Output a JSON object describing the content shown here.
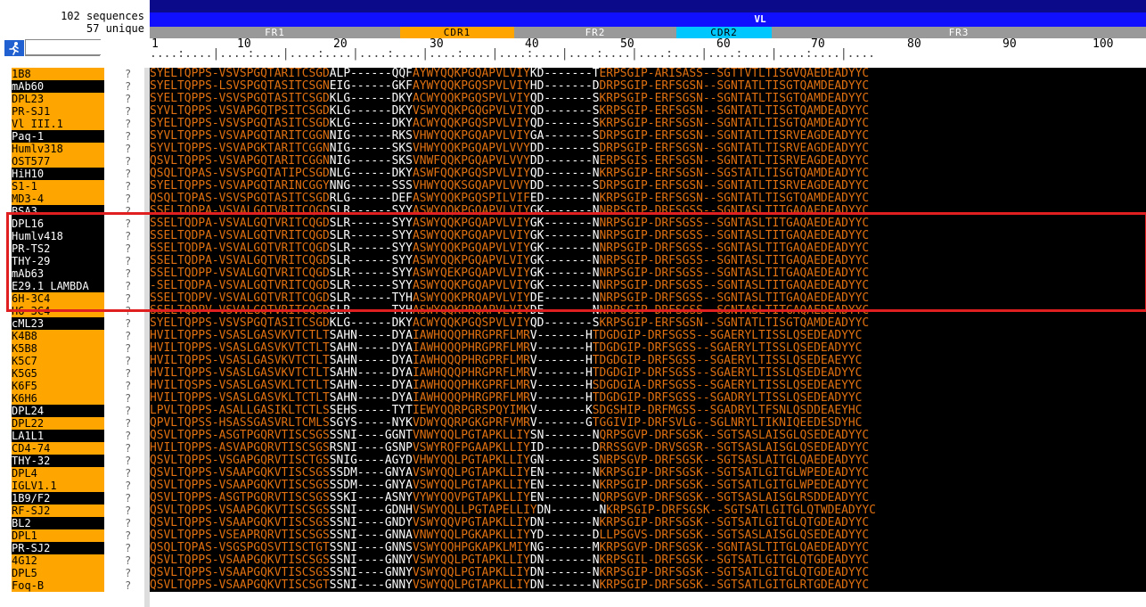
{
  "header": {
    "sequence_count": "102 sequences",
    "unique_count": "57 unique"
  },
  "domain_label": "VL",
  "regions": [
    {
      "label": "FR1",
      "type": "fr"
    },
    {
      "label": "CDR1",
      "type": "cdr1"
    },
    {
      "label": "FR2",
      "type": "fr"
    },
    {
      "label": "CDR2",
      "type": "cdr2"
    },
    {
      "label": "FR3",
      "type": "fr"
    }
  ],
  "ruler": {
    "ticks": [
      "1",
      "10",
      "20",
      "30",
      "40",
      "50",
      "60",
      "70",
      "80",
      "90",
      "100"
    ],
    "dots": "....:....|....:....|....:....|....:....|....:....|....:....|....:....|....:....|....:....|....:....|...."
  },
  "search": {
    "placeholder": ""
  },
  "colors": {
    "orange_name": "#ffa500",
    "residue": "#e07010",
    "cdr": "#ffffff",
    "highlight": "#e02020"
  },
  "sequences": [
    {
      "name": "1B8",
      "style": "orange",
      "q": "?",
      "fr1": "SYELTQPPS-VSVSPGQTARITCSGD",
      "cdr1": "ALP------QQF",
      "fr2": "AYWYQQKPGQAPVLVIY",
      "cdr2": "KD-------T",
      "fr3": "ERPSGIP-ARISASS--SGTTVTLTISGVQAEDEADYYC"
    },
    {
      "name": "mAb60",
      "style": "black",
      "q": "?",
      "fr1": "SYELTQPPS-LSVSPGQTASITCSGN",
      "cdr1": "EIG------GKF",
      "fr2": "AYWYQQKPGQSPVLVIY",
      "cdr2": "HD-------D",
      "fr3": "DRPSGIP-ERFSGSN--SGNTATLTISGTQAMDEADYYC"
    },
    {
      "name": "DPL23",
      "style": "orange",
      "q": "?",
      "fr1": "SYELTQPPS-VSVSPGQTASITCSGD",
      "cdr1": "KLG------DKY",
      "fr2": "ACWYQQKPGQSPVLVIY",
      "cdr2": "QD-------S",
      "fr3": "KRPSGIP-ERFSGSN--SGNTATLTISGTQAMDEADYYC"
    },
    {
      "name": "PR-SJ1",
      "style": "orange",
      "q": "?",
      "fr1": "SYVLTQPPS-VSVAPGQTPSITCSGD",
      "cdr1": "KLG------DKY",
      "fr2": "VSWYQQKPGQGPVLVIY",
      "cdr2": "QD-------S",
      "fr3": "KRPSGIP-ERFSGSN--SGNTATLTISGTQAMDEADYYC"
    },
    {
      "name": "Vl III.1",
      "style": "orange",
      "q": "?",
      "fr1": "SYELTQPPS-VSVSPGQTASITCSGD",
      "cdr1": "KLG------DKY",
      "fr2": "ACWYQQKPGQSPVLVIY",
      "cdr2": "QD-------S",
      "fr3": "KRPSGIP-ERFSGSN--SGNTATLTISGTQAMDEADYYC"
    },
    {
      "name": "Paq-1",
      "style": "black",
      "q": "?",
      "fr1": "SYVLTQPPS-VSVAPGQTARITCGGN",
      "cdr1": "NIG------RKS",
      "fr2": "VHWYQQKPGQAPVLVIY",
      "cdr2": "GA-------S",
      "fr3": "DRPSGIP-ERFSGSN--SGNTATLTISRVEAGDEADYYC"
    },
    {
      "name": "Humlv318",
      "style": "orange",
      "q": "?",
      "fr1": "SYVLTQPPS-VSVAPGKTARITCGGN",
      "cdr1": "NIG------SKS",
      "fr2": "VHWYQQKPGQAPVLVVY",
      "cdr2": "DD-------S",
      "fr3": "DRPSGIP-ERFSGSN--SGNTATLTISRVEAGDEADYYC"
    },
    {
      "name": "OST577",
      "style": "orange",
      "q": "?",
      "fr1": "QSVLTQPPS-VSVAPGQTARITCGGN",
      "cdr1": "NIG------SKS",
      "fr2": "VNWFQQKPGQAPVLVVY",
      "cdr2": "DD-------N",
      "fr3": "ERPSGIS-ERFSGSN--SGNTATLTISRVEAGDEADYYC"
    },
    {
      "name": "HiH10",
      "style": "black",
      "q": "?",
      "fr1": "QSQLTQPAS-VSVSPGQTATIPCSGD",
      "cdr1": "NLG------DKY",
      "fr2": "ASWFQQKPGQSPVLVIY",
      "cdr2": "QD-------N",
      "fr3": "KRPSGIP-ERFSGSN--SGSTATLTISGTQAMDEADYYC"
    },
    {
      "name": "S1-1",
      "style": "orange",
      "q": "?",
      "fr1": "SYELTQPPS-VSVAPGQTARINCGGY",
      "cdr1": "NNG------SSS",
      "fr2": "VHWYQQKSGQAPVLVVY",
      "cdr2": "DD-------S",
      "fr3": "DRPSGIP-ERFSGSN--SGNTATLTISRVEAGDEADYYC"
    },
    {
      "name": "MD3-4",
      "style": "orange",
      "q": "?",
      "fr1": "QSQLTQPAS-VSVSPGQTASITCSGD",
      "cdr1": "RLG------DEF",
      "fr2": "ASWYQQKPGQSPILVIF",
      "cdr2": "ED-------N",
      "fr3": "KRPSGIP-ERFSGSN--SGNTATLTISGTQAMDEADYYC"
    },
    {
      "name": "BSA3",
      "style": "black",
      "q": "?",
      "fr1": "SSELTQDPA-VSVALGQTVRITCQGD",
      "cdr1": "SLR------SYY",
      "fr2": "ASWYQQKPGQAPVLVIY",
      "cdr2": "GK-------N",
      "fr3": "NRPSGIP-DRFSGSS--SGNTASLTITGAQAEDEADYYC"
    },
    {
      "name": "DPL16",
      "style": "black",
      "q": "?",
      "fr1": "SSELTQDPA-VSVALGQTVRITCQGD",
      "cdr1": "SLR------SYY",
      "fr2": "ASWYQQKPGQAPVLVIY",
      "cdr2": "GK-------N",
      "fr3": "NRPSGIP-DRFSGSS--SGNTASLTITGAQAEDEADYYC"
    },
    {
      "name": "Humlv418",
      "style": "black",
      "q": "?",
      "fr1": "SSELTQDPA-VSVALGQTVRITCQGD",
      "cdr1": "SLR------SYY",
      "fr2": "ASWYQQKPGQAPVLVIY",
      "cdr2": "GK-------N",
      "fr3": "NRPSGIP-DRFSGSS--SGNTASLTITGAQAEDEADYYC"
    },
    {
      "name": "PR-TS2",
      "style": "black",
      "q": "?",
      "fr1": "SSELTQDPA-VSVALGQTVRITCQGD",
      "cdr1": "SLR------SYY",
      "fr2": "ASWYQQKPGQAPVLVIY",
      "cdr2": "GK-------N",
      "fr3": "NRPSGIP-DRFSGSS--SGNTASLTITGAQAEDEADYYC"
    },
    {
      "name": "THY-29",
      "style": "black",
      "q": "?",
      "fr1": "SSELTQDPA-VSVALGQTVRITCQGD",
      "cdr1": "SLR------SYY",
      "fr2": "ASWYQQKPGQAPVLVIY",
      "cdr2": "GK-------N",
      "fr3": "NRPSGIP-DRFSGSS--SGNTASLTITGAQAEDEADYYC"
    },
    {
      "name": "mAb63",
      "style": "black",
      "q": "?",
      "fr1": "SSELTQDPP-VSVALGQTVRITCQGD",
      "cdr1": "SLR------SYY",
      "fr2": "ASWYQEKPGQAPVLVIY",
      "cdr2": "GK-------N",
      "fr3": "NRPSGIP-DRFSGSS--SGNTASLTITGAQAEDEADYYC"
    },
    {
      "name": "E29.1 LAMBDA",
      "style": "black",
      "q": "?",
      "fr1": "-SELTQDPA-VSVALGQTVRITCQGD",
      "cdr1": "SLR------SYY",
      "fr2": "ASWYQQKPGQAPVLVIY",
      "cdr2": "GK-------N",
      "fr3": "NRPSGIP-DRFSGSS--SGNTASLTITGAQAEDEADYYC"
    },
    {
      "name": "6H-3C4",
      "style": "orange",
      "q": "?",
      "fr1": "SSELTQDPV-VSVALGQTVRITCQGD",
      "cdr1": "SLR------TYH",
      "fr2": "ASWYQQKPRQAPVLVIY",
      "cdr2": "DE-------N",
      "fr3": "NRPSGIP-DRFSGSS--SGNTASLTITGAQAEDEADYYC"
    },
    {
      "name": "H6-3C4",
      "style": "orange",
      "q": "?",
      "fr1": "SSELTQDPV-VSVALGQTVRITCQGD",
      "cdr1": "SLR------TYH",
      "fr2": "ASWYQQKPRQAPVLVIY",
      "cdr2": "DE-------N",
      "fr3": "NRPSGIP-DRFSGSS--SGNTASLTITGAQAEDEADYYC"
    },
    {
      "name": "cML23",
      "style": "black",
      "q": "?",
      "fr1": "SYELTQPPS-VSVSPGQTASITCSGD",
      "cdr1": "KLG------DKY",
      "fr2": "ACWYQQKPGQSPVLVIY",
      "cdr2": "QD-------S",
      "fr3": "KRPSGIP-ERFSGSN--SGNTATLTISGTQAMDEADYYC"
    },
    {
      "name": "K4B8",
      "style": "orange",
      "q": "?",
      "fr1": "HVILTQPPS-VSASLGASVKVTCTLT",
      "cdr1": "SAHN-----DYA",
      "fr2": "IAWHQQQPHRGPRFLMR",
      "cdr2": "V-------H",
      "fr3": "TDGDGIP-DRFSGSS--SGAERYLTISSLQSEDEADYYC"
    },
    {
      "name": "K5B8",
      "style": "orange",
      "q": "?",
      "fr1": "HVILTQPPS-VSASLGASVKVTCTLT",
      "cdr1": "SAHN-----DYA",
      "fr2": "IAWHQQQPHRGPRFLMR",
      "cdr2": "V-------H",
      "fr3": "TDGDGIP-DRFSGSS--SGAERYLTISSLQSEDEADYYC"
    },
    {
      "name": "K5C7",
      "style": "orange",
      "q": "?",
      "fr1": "HVILTQPPS-VSASLGASVKVTCTLT",
      "cdr1": "SAHN-----DYA",
      "fr2": "IAWHQQQPHRGPRFLMR",
      "cdr2": "V-------H",
      "fr3": "TDGDGIP-DRFSGSS--SGAERYLTISSLQSEDEAEYYC"
    },
    {
      "name": "K5G5",
      "style": "orange",
      "q": "?",
      "fr1": "HVILTQPPS-VSASLGASVKVTCTLT",
      "cdr1": "SAHN-----DYA",
      "fr2": "IAWHQQQPHRGPRFLMR",
      "cdr2": "V-------H",
      "fr3": "TDGDGIP-DRFSGSS--SGAERYLTISSLQSEDEADYYC"
    },
    {
      "name": "K6F5",
      "style": "orange",
      "q": "?",
      "fr1": "HVILTQSPS-VSASLGASVKLTCTLT",
      "cdr1": "SAHN-----DYA",
      "fr2": "IAWHQQQPHKGPRFLMR",
      "cdr2": "V-------H",
      "fr3": "SDGDGIA-DRFSGSS--SGAERYLTISSLQSEDEAEYYC"
    },
    {
      "name": "K6H6",
      "style": "orange",
      "q": "?",
      "fr1": "HVILTQPPS-VSASLGASVKLTCTLT",
      "cdr1": "SAHN-----DYA",
      "fr2": "IAWHQQQPHRGPRFLMR",
      "cdr2": "V-------H",
      "fr3": "TDGDGIP-DRFSGSS--SGADRYLTISSLQSEDEADYYC"
    },
    {
      "name": "DPL24",
      "style": "black",
      "q": "?",
      "fr1": "LPVLTQPPS-ASALLGASIKLTCTLS",
      "cdr1": "SEHS-----TYT",
      "fr2": "IEWYQQRPGRSPQYIMK",
      "cdr2": "V-------K",
      "fr3": "SDGSHIP-DRFMGSS--SGADRYLTFSNLQSDDEAEYHC"
    },
    {
      "name": "DPL22",
      "style": "orange",
      "q": "?",
      "fr1": "QPVLTQPSS-HSASSGASVRLTCMLS",
      "cdr1": "SGYS-----NYK",
      "fr2": "VDWYQQRPGKGPRFVMR",
      "cdr2": "V-------G",
      "fr3": "TGGIVIP-DRFSVLG--SGLNRYLTIKNIQEEDESDYHC"
    },
    {
      "name": "LA1L1",
      "style": "black",
      "q": "?",
      "fr1": "QSVLTQPPS-ASGTPGQRVTISCSGS",
      "cdr1": "SSNI----GGNT",
      "fr2": "VNWYQQLPGTAPKLLIY",
      "cdr2": "SN-------N",
      "fr3": "QRPSGVP-DRFSGSK--SGTSASLAISGLQSEDEADYYC"
    },
    {
      "name": "CD4-74",
      "style": "orange",
      "q": "?",
      "fr1": "HVILTQPPS-ASVAPGQRVTISCSGS",
      "cdr1": "RSNI----GSNP",
      "fr2": "VSWYRQFPGAAPKLLIY",
      "cdr2": "ID-------D",
      "fr3": "RRSSGVP-DRVSGSR--SGTSASLAISGLQSEDEADYYC"
    },
    {
      "name": "THY-32",
      "style": "black",
      "q": "?",
      "fr1": "QSVLTQPPS-VSGAPGQRVTISCTGS",
      "cdr1": "SNIG----AGYD",
      "fr2": "VHWYQQLPGTAPKLLIY",
      "cdr2": "GN-------S",
      "fr3": "NRPSGVP-DRFSGSK--SGTSASLAITGLQAEDEADYYC"
    },
    {
      "name": "DPL4",
      "style": "orange",
      "q": "?",
      "fr1": "QSVLTQPPS-VSAAPGQKVTISCSGS",
      "cdr1": "SSDM----GNYA",
      "fr2": "VSWYQQLPGTAPKLLIY",
      "cdr2": "EN-------N",
      "fr3": "KRPSGIP-DRFSGSK--SGTSATLGITGLWPEDEADYYC"
    },
    {
      "name": "IGLV1.1",
      "style": "orange",
      "q": "?",
      "fr1": "QSVLTQPPS-VSAAPGQKVTISCSGS",
      "cdr1": "SSDM----GNYA",
      "fr2": "VSWYQQLPGTAPKLLIY",
      "cdr2": "EN-------N",
      "fr3": "KRPSGIP-DRFSGSK--SGTSATLGITGLWPEDEADYYC"
    },
    {
      "name": "1B9/F2",
      "style": "black",
      "q": "?",
      "fr1": "QSVLTQPPS-ASGTPGQRVTISCSGS",
      "cdr1": "SSKI----ASNY",
      "fr2": "VYWYQQVPGTAPKLLIY",
      "cdr2": "EN-------N",
      "fr3": "QRPSGVP-DRFSGSK--SGTSASLAISGLRSDDEADYYC"
    },
    {
      "name": "RF-SJ2",
      "style": "orange",
      "q": "?",
      "fr1": "QSVLTQPPS-VSAAPGQKVTISCSGS",
      "cdr1": "SSNI----GDNH",
      "fr2": "VSWYQQLLPGTAPELLIY",
      "cdr2": "DN-------N",
      "fr3": "KRPSGIP-DRFSGSK--SGTSATLGITGLQTWDEADYYC"
    },
    {
      "name": "BL2",
      "style": "black",
      "q": "?",
      "fr1": "QSVLTQPPS-VSAAPGQKVTISCSGS",
      "cdr1": "SSNI----GNDY",
      "fr2": "VSWYQQVPGTAPKLLIY",
      "cdr2": "DN-------N",
      "fr3": "KRPSGIP-DRFSGSK--SGTSATLGITGLQTGDEADYYC"
    },
    {
      "name": "DPL1",
      "style": "orange",
      "q": "?",
      "fr1": "QSVLTQPPS-VSEAPRQRVTISCSGS",
      "cdr1": "SSNI----GNNA",
      "fr2": "VNWYQQLPGKAPKLLIY",
      "cdr2": "YD-------D",
      "fr3": "LLPSGVS-DRFSGSK--SGTSASLAISGLQSEDEADYYC"
    },
    {
      "name": "PR-SJ2",
      "style": "black",
      "q": "?",
      "fr1": "QSQLTQPAS-VSGSPGQSVTISCTGT",
      "cdr1": "SSNI----GNNS",
      "fr2": "VSWYQQHPGKAPKLMIY",
      "cdr2": "NG-------M",
      "fr3": "KRPSGVP-DRFSGSK--SGNTASLTITGLQAEDEADYYC"
    },
    {
      "name": "4G12",
      "style": "orange",
      "q": "?",
      "fr1": "QSVLTQPPS-VSAAPGQKVTISCSGS",
      "cdr1": "SSNI----GNNY",
      "fr2": "VSWYQQLPGTAPKLLIY",
      "cdr2": "DN-------N",
      "fr3": "KRPSGIL-DRFSGSK--SGTSATLGITGLQTGDEADYYC"
    },
    {
      "name": "DPL5",
      "style": "orange",
      "q": "?",
      "fr1": "QSVLTQPPS-VSAAPGQKVTISCSGS",
      "cdr1": "SSNI----GNNY",
      "fr2": "VSWYQQLPGTAPKLLIY",
      "cdr2": "DN-------N",
      "fr3": "KRPSGIP-DRFSGSK--SGTSATLGITGLQTGDEADYYC"
    },
    {
      "name": "Foq-B",
      "style": "orange",
      "q": "?",
      "fr1": "QSVLTQPPS-VSAAPGQKVTISCSGT",
      "cdr1": "SSNI----GNNY",
      "fr2": "VSWYQQLPGTAPKLLIY",
      "cdr2": "DN-------N",
      "fr3": "KRPSGIP-DRFSGSK--SGTSATLGITGLRTGDEADYYC"
    }
  ]
}
